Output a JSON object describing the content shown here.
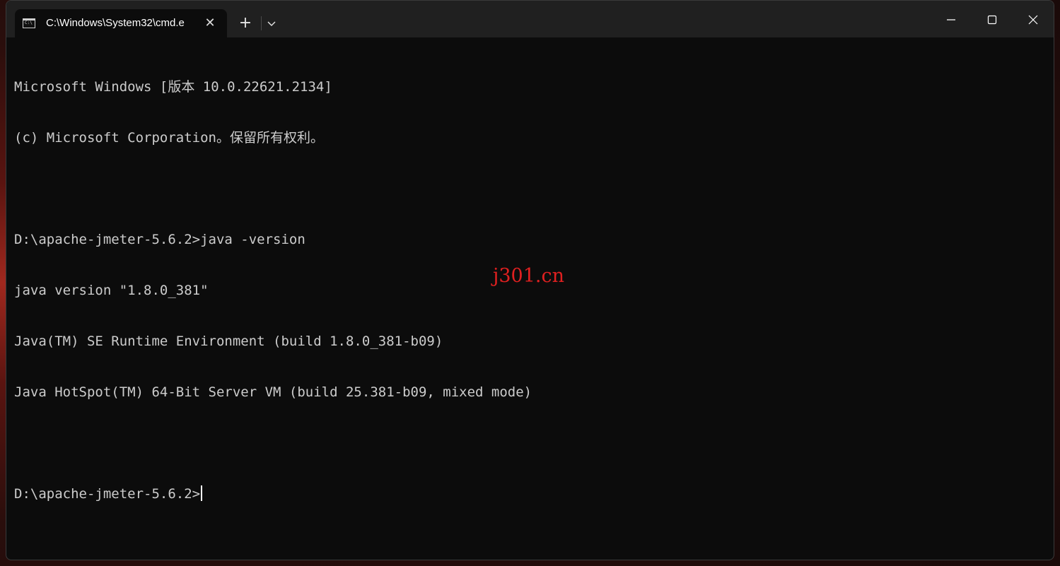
{
  "window": {
    "tab_title": "C:\\Windows\\System32\\cmd.e",
    "new_tab_icon": "plus-icon",
    "dropdown_icon": "chevron-down-icon",
    "minimize_icon": "minimize-icon",
    "maximize_icon": "maximize-icon",
    "close_icon": "close-icon"
  },
  "console": {
    "lines": [
      "Microsoft Windows [版本 10.0.22621.2134]",
      "(c) Microsoft Corporation。保留所有权利。",
      "",
      "D:\\apache-jmeter-5.6.2>java -version",
      "java version \"1.8.0_381\"",
      "Java(TM) SE Runtime Environment (build 1.8.0_381-b09)",
      "Java HotSpot(TM) 64-Bit Server VM (build 25.381-b09, mixed mode)",
      "",
      "D:\\apache-jmeter-5.6.2>"
    ]
  },
  "watermark": "j301.cn",
  "colors": {
    "console_bg": "#0c0c0c",
    "console_text": "#cccccc",
    "titlebar_bg": "#202020",
    "watermark": "#e02020"
  }
}
